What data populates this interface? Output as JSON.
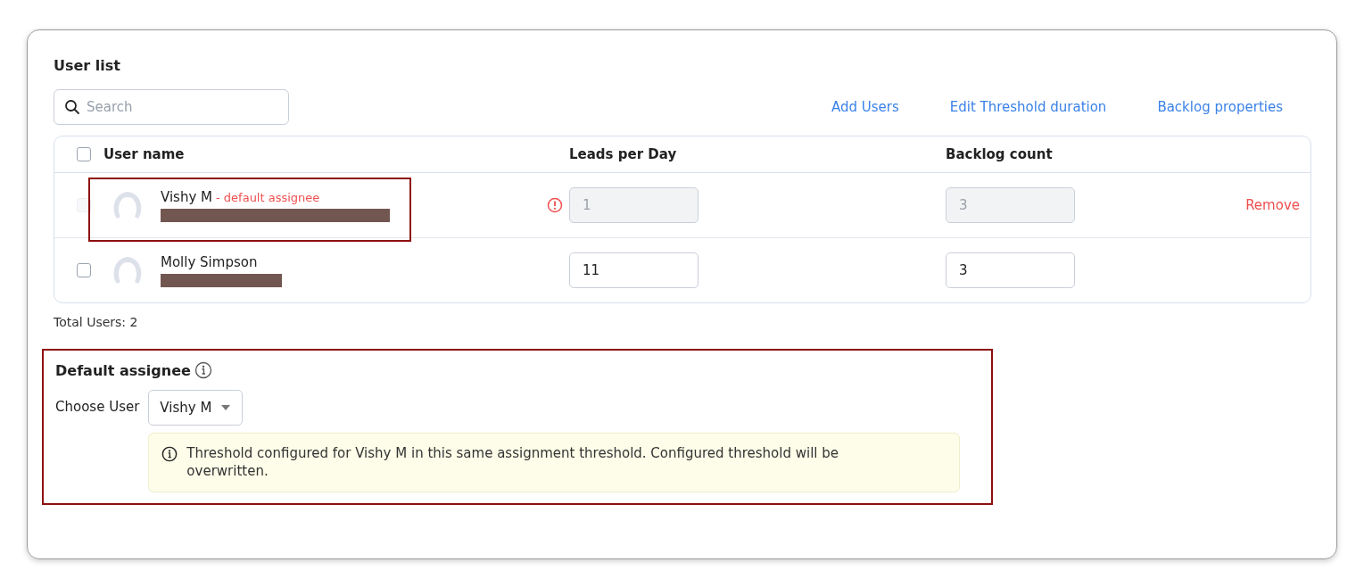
{
  "section_title": "User list",
  "search": {
    "placeholder": "Search"
  },
  "actions": [
    "Add Users",
    "Edit Threshold duration",
    "Backlog properties"
  ],
  "table": {
    "columns": [
      "User name",
      "Leads per Day",
      "Backlog count"
    ],
    "header_checked": false,
    "rows": [
      {
        "name": "Vishy M",
        "tag": "- default assignee",
        "checked": false,
        "disabled": true,
        "warning": true,
        "highlighted": true,
        "redacted": true,
        "leads_per_day": "1",
        "backlog_count": "3",
        "action": "Remove"
      },
      {
        "name": "Molly Simpson",
        "checked": false,
        "disabled": false,
        "warning": false,
        "highlighted": false,
        "redacted": true,
        "leads_per_day": "11",
        "backlog_count": "3"
      }
    ]
  },
  "total": "Total Users: 2",
  "default_assignee": {
    "title": "Default assignee",
    "highlighted": true,
    "label": "Choose User",
    "selected_user": "Vishy M",
    "notice": "Threshold configured for Vishy M in this same assignment threshold. Configured threshold will be overwritten."
  }
}
